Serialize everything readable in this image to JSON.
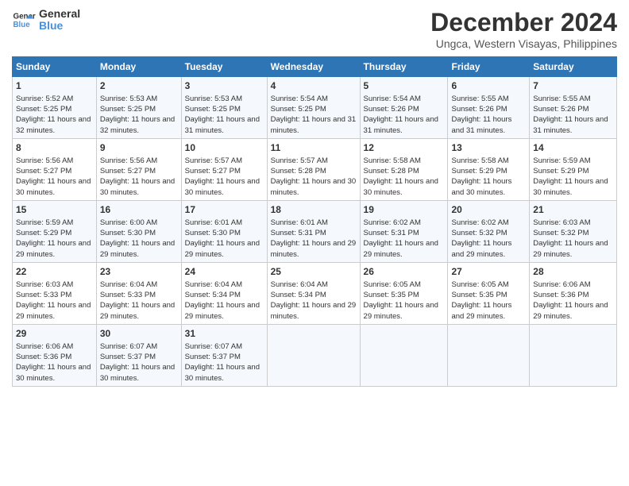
{
  "logo": {
    "line1": "General",
    "line2": "Blue"
  },
  "title": "December 2024",
  "subtitle": "Ungca, Western Visayas, Philippines",
  "days_of_week": [
    "Sunday",
    "Monday",
    "Tuesday",
    "Wednesday",
    "Thursday",
    "Friday",
    "Saturday"
  ],
  "weeks": [
    [
      {
        "day": "1",
        "sunrise": "Sunrise: 5:52 AM",
        "sunset": "Sunset: 5:25 PM",
        "daylight": "Daylight: 11 hours and 32 minutes."
      },
      {
        "day": "2",
        "sunrise": "Sunrise: 5:53 AM",
        "sunset": "Sunset: 5:25 PM",
        "daylight": "Daylight: 11 hours and 32 minutes."
      },
      {
        "day": "3",
        "sunrise": "Sunrise: 5:53 AM",
        "sunset": "Sunset: 5:25 PM",
        "daylight": "Daylight: 11 hours and 31 minutes."
      },
      {
        "day": "4",
        "sunrise": "Sunrise: 5:54 AM",
        "sunset": "Sunset: 5:25 PM",
        "daylight": "Daylight: 11 hours and 31 minutes."
      },
      {
        "day": "5",
        "sunrise": "Sunrise: 5:54 AM",
        "sunset": "Sunset: 5:26 PM",
        "daylight": "Daylight: 11 hours and 31 minutes."
      },
      {
        "day": "6",
        "sunrise": "Sunrise: 5:55 AM",
        "sunset": "Sunset: 5:26 PM",
        "daylight": "Daylight: 11 hours and 31 minutes."
      },
      {
        "day": "7",
        "sunrise": "Sunrise: 5:55 AM",
        "sunset": "Sunset: 5:26 PM",
        "daylight": "Daylight: 11 hours and 31 minutes."
      }
    ],
    [
      {
        "day": "8",
        "sunrise": "Sunrise: 5:56 AM",
        "sunset": "Sunset: 5:27 PM",
        "daylight": "Daylight: 11 hours and 30 minutes."
      },
      {
        "day": "9",
        "sunrise": "Sunrise: 5:56 AM",
        "sunset": "Sunset: 5:27 PM",
        "daylight": "Daylight: 11 hours and 30 minutes."
      },
      {
        "day": "10",
        "sunrise": "Sunrise: 5:57 AM",
        "sunset": "Sunset: 5:27 PM",
        "daylight": "Daylight: 11 hours and 30 minutes."
      },
      {
        "day": "11",
        "sunrise": "Sunrise: 5:57 AM",
        "sunset": "Sunset: 5:28 PM",
        "daylight": "Daylight: 11 hours and 30 minutes."
      },
      {
        "day": "12",
        "sunrise": "Sunrise: 5:58 AM",
        "sunset": "Sunset: 5:28 PM",
        "daylight": "Daylight: 11 hours and 30 minutes."
      },
      {
        "day": "13",
        "sunrise": "Sunrise: 5:58 AM",
        "sunset": "Sunset: 5:29 PM",
        "daylight": "Daylight: 11 hours and 30 minutes."
      },
      {
        "day": "14",
        "sunrise": "Sunrise: 5:59 AM",
        "sunset": "Sunset: 5:29 PM",
        "daylight": "Daylight: 11 hours and 30 minutes."
      }
    ],
    [
      {
        "day": "15",
        "sunrise": "Sunrise: 5:59 AM",
        "sunset": "Sunset: 5:29 PM",
        "daylight": "Daylight: 11 hours and 29 minutes."
      },
      {
        "day": "16",
        "sunrise": "Sunrise: 6:00 AM",
        "sunset": "Sunset: 5:30 PM",
        "daylight": "Daylight: 11 hours and 29 minutes."
      },
      {
        "day": "17",
        "sunrise": "Sunrise: 6:01 AM",
        "sunset": "Sunset: 5:30 PM",
        "daylight": "Daylight: 11 hours and 29 minutes."
      },
      {
        "day": "18",
        "sunrise": "Sunrise: 6:01 AM",
        "sunset": "Sunset: 5:31 PM",
        "daylight": "Daylight: 11 hours and 29 minutes."
      },
      {
        "day": "19",
        "sunrise": "Sunrise: 6:02 AM",
        "sunset": "Sunset: 5:31 PM",
        "daylight": "Daylight: 11 hours and 29 minutes."
      },
      {
        "day": "20",
        "sunrise": "Sunrise: 6:02 AM",
        "sunset": "Sunset: 5:32 PM",
        "daylight": "Daylight: 11 hours and 29 minutes."
      },
      {
        "day": "21",
        "sunrise": "Sunrise: 6:03 AM",
        "sunset": "Sunset: 5:32 PM",
        "daylight": "Daylight: 11 hours and 29 minutes."
      }
    ],
    [
      {
        "day": "22",
        "sunrise": "Sunrise: 6:03 AM",
        "sunset": "Sunset: 5:33 PM",
        "daylight": "Daylight: 11 hours and 29 minutes."
      },
      {
        "day": "23",
        "sunrise": "Sunrise: 6:04 AM",
        "sunset": "Sunset: 5:33 PM",
        "daylight": "Daylight: 11 hours and 29 minutes."
      },
      {
        "day": "24",
        "sunrise": "Sunrise: 6:04 AM",
        "sunset": "Sunset: 5:34 PM",
        "daylight": "Daylight: 11 hours and 29 minutes."
      },
      {
        "day": "25",
        "sunrise": "Sunrise: 6:04 AM",
        "sunset": "Sunset: 5:34 PM",
        "daylight": "Daylight: 11 hours and 29 minutes."
      },
      {
        "day": "26",
        "sunrise": "Sunrise: 6:05 AM",
        "sunset": "Sunset: 5:35 PM",
        "daylight": "Daylight: 11 hours and 29 minutes."
      },
      {
        "day": "27",
        "sunrise": "Sunrise: 6:05 AM",
        "sunset": "Sunset: 5:35 PM",
        "daylight": "Daylight: 11 hours and 29 minutes."
      },
      {
        "day": "28",
        "sunrise": "Sunrise: 6:06 AM",
        "sunset": "Sunset: 5:36 PM",
        "daylight": "Daylight: 11 hours and 29 minutes."
      }
    ],
    [
      {
        "day": "29",
        "sunrise": "Sunrise: 6:06 AM",
        "sunset": "Sunset: 5:36 PM",
        "daylight": "Daylight: 11 hours and 30 minutes."
      },
      {
        "day": "30",
        "sunrise": "Sunrise: 6:07 AM",
        "sunset": "Sunset: 5:37 PM",
        "daylight": "Daylight: 11 hours and 30 minutes."
      },
      {
        "day": "31",
        "sunrise": "Sunrise: 6:07 AM",
        "sunset": "Sunset: 5:37 PM",
        "daylight": "Daylight: 11 hours and 30 minutes."
      },
      null,
      null,
      null,
      null
    ]
  ]
}
